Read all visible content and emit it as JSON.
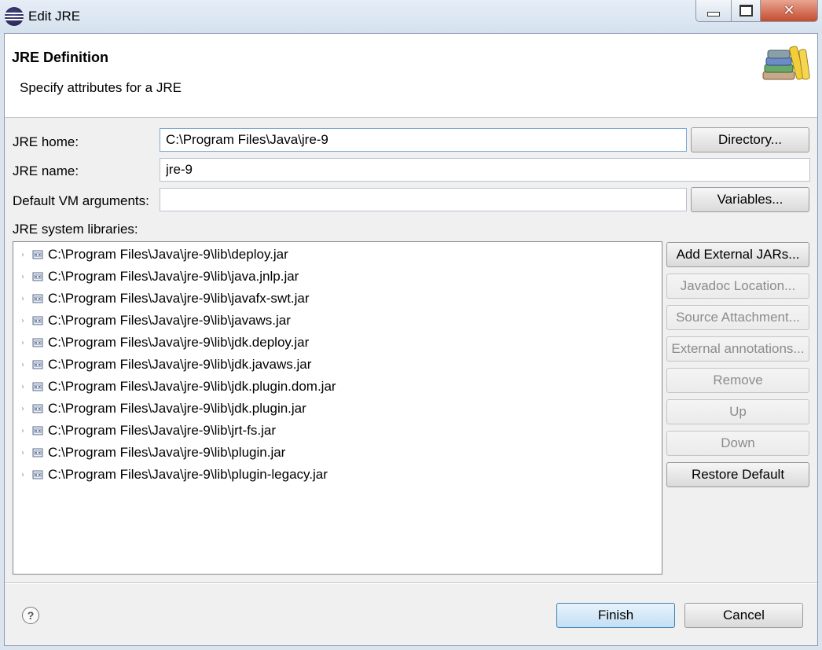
{
  "window": {
    "title": "Edit JRE",
    "minimize_glyph": "",
    "close_glyph": "✕"
  },
  "header": {
    "title": "JRE Definition",
    "description": "Specify attributes for a JRE",
    "art_icon": "library-books-icon"
  },
  "form": {
    "jre_home_label": "JRE home:",
    "jre_home_value": "C:\\Program Files\\Java\\jre-9",
    "directory_button": "Directory...",
    "jre_name_label": "JRE name:",
    "jre_name_value": "jre-9",
    "vm_args_label": "Default VM arguments:",
    "vm_args_value": "",
    "variables_button": "Variables...",
    "libraries_label": "JRE system libraries:"
  },
  "libraries": [
    "C:\\Program Files\\Java\\jre-9\\lib\\deploy.jar",
    "C:\\Program Files\\Java\\jre-9\\lib\\java.jnlp.jar",
    "C:\\Program Files\\Java\\jre-9\\lib\\javafx-swt.jar",
    "C:\\Program Files\\Java\\jre-9\\lib\\javaws.jar",
    "C:\\Program Files\\Java\\jre-9\\lib\\jdk.deploy.jar",
    "C:\\Program Files\\Java\\jre-9\\lib\\jdk.javaws.jar",
    "C:\\Program Files\\Java\\jre-9\\lib\\jdk.plugin.dom.jar",
    "C:\\Program Files\\Java\\jre-9\\lib\\jdk.plugin.jar",
    "C:\\Program Files\\Java\\jre-9\\lib\\jrt-fs.jar",
    "C:\\Program Files\\Java\\jre-9\\lib\\plugin.jar",
    "C:\\Program Files\\Java\\jre-9\\lib\\plugin-legacy.jar"
  ],
  "side_buttons": {
    "add_external_jars": "Add External JARs...",
    "javadoc_location": "Javadoc Location...",
    "source_attachment": "Source Attachment...",
    "external_annotations": "External annotations...",
    "remove": "Remove",
    "up": "Up",
    "down": "Down",
    "restore_default": "Restore Default"
  },
  "footer": {
    "help_glyph": "?",
    "finish": "Finish",
    "cancel": "Cancel"
  }
}
